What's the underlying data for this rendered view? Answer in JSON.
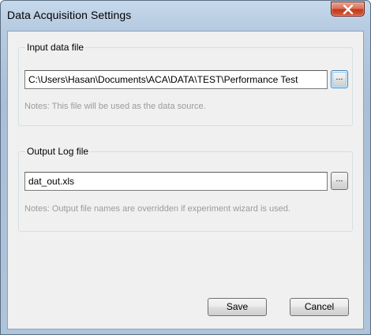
{
  "window": {
    "title": "Data Acquisition Settings"
  },
  "input_group": {
    "legend": "Input data file",
    "path_value": "C:\\Users\\Hasan\\Documents\\ACA\\DATA\\TEST\\Performance Test",
    "browse_label": "...",
    "note": "Notes: This file will be used as the data source."
  },
  "output_group": {
    "legend": "Output Log file",
    "file_value": "dat_out.xls",
    "browse_label": "...",
    "note": "Notes: Output file names are overridden if experiment wizard is used."
  },
  "footer": {
    "save_label": "Save",
    "cancel_label": "Cancel"
  },
  "icons": {
    "close": "close-icon"
  },
  "colors": {
    "close_button": "#c2391d",
    "note_text": "#9b9b9b",
    "focus_ring": "#3c7fb1"
  }
}
